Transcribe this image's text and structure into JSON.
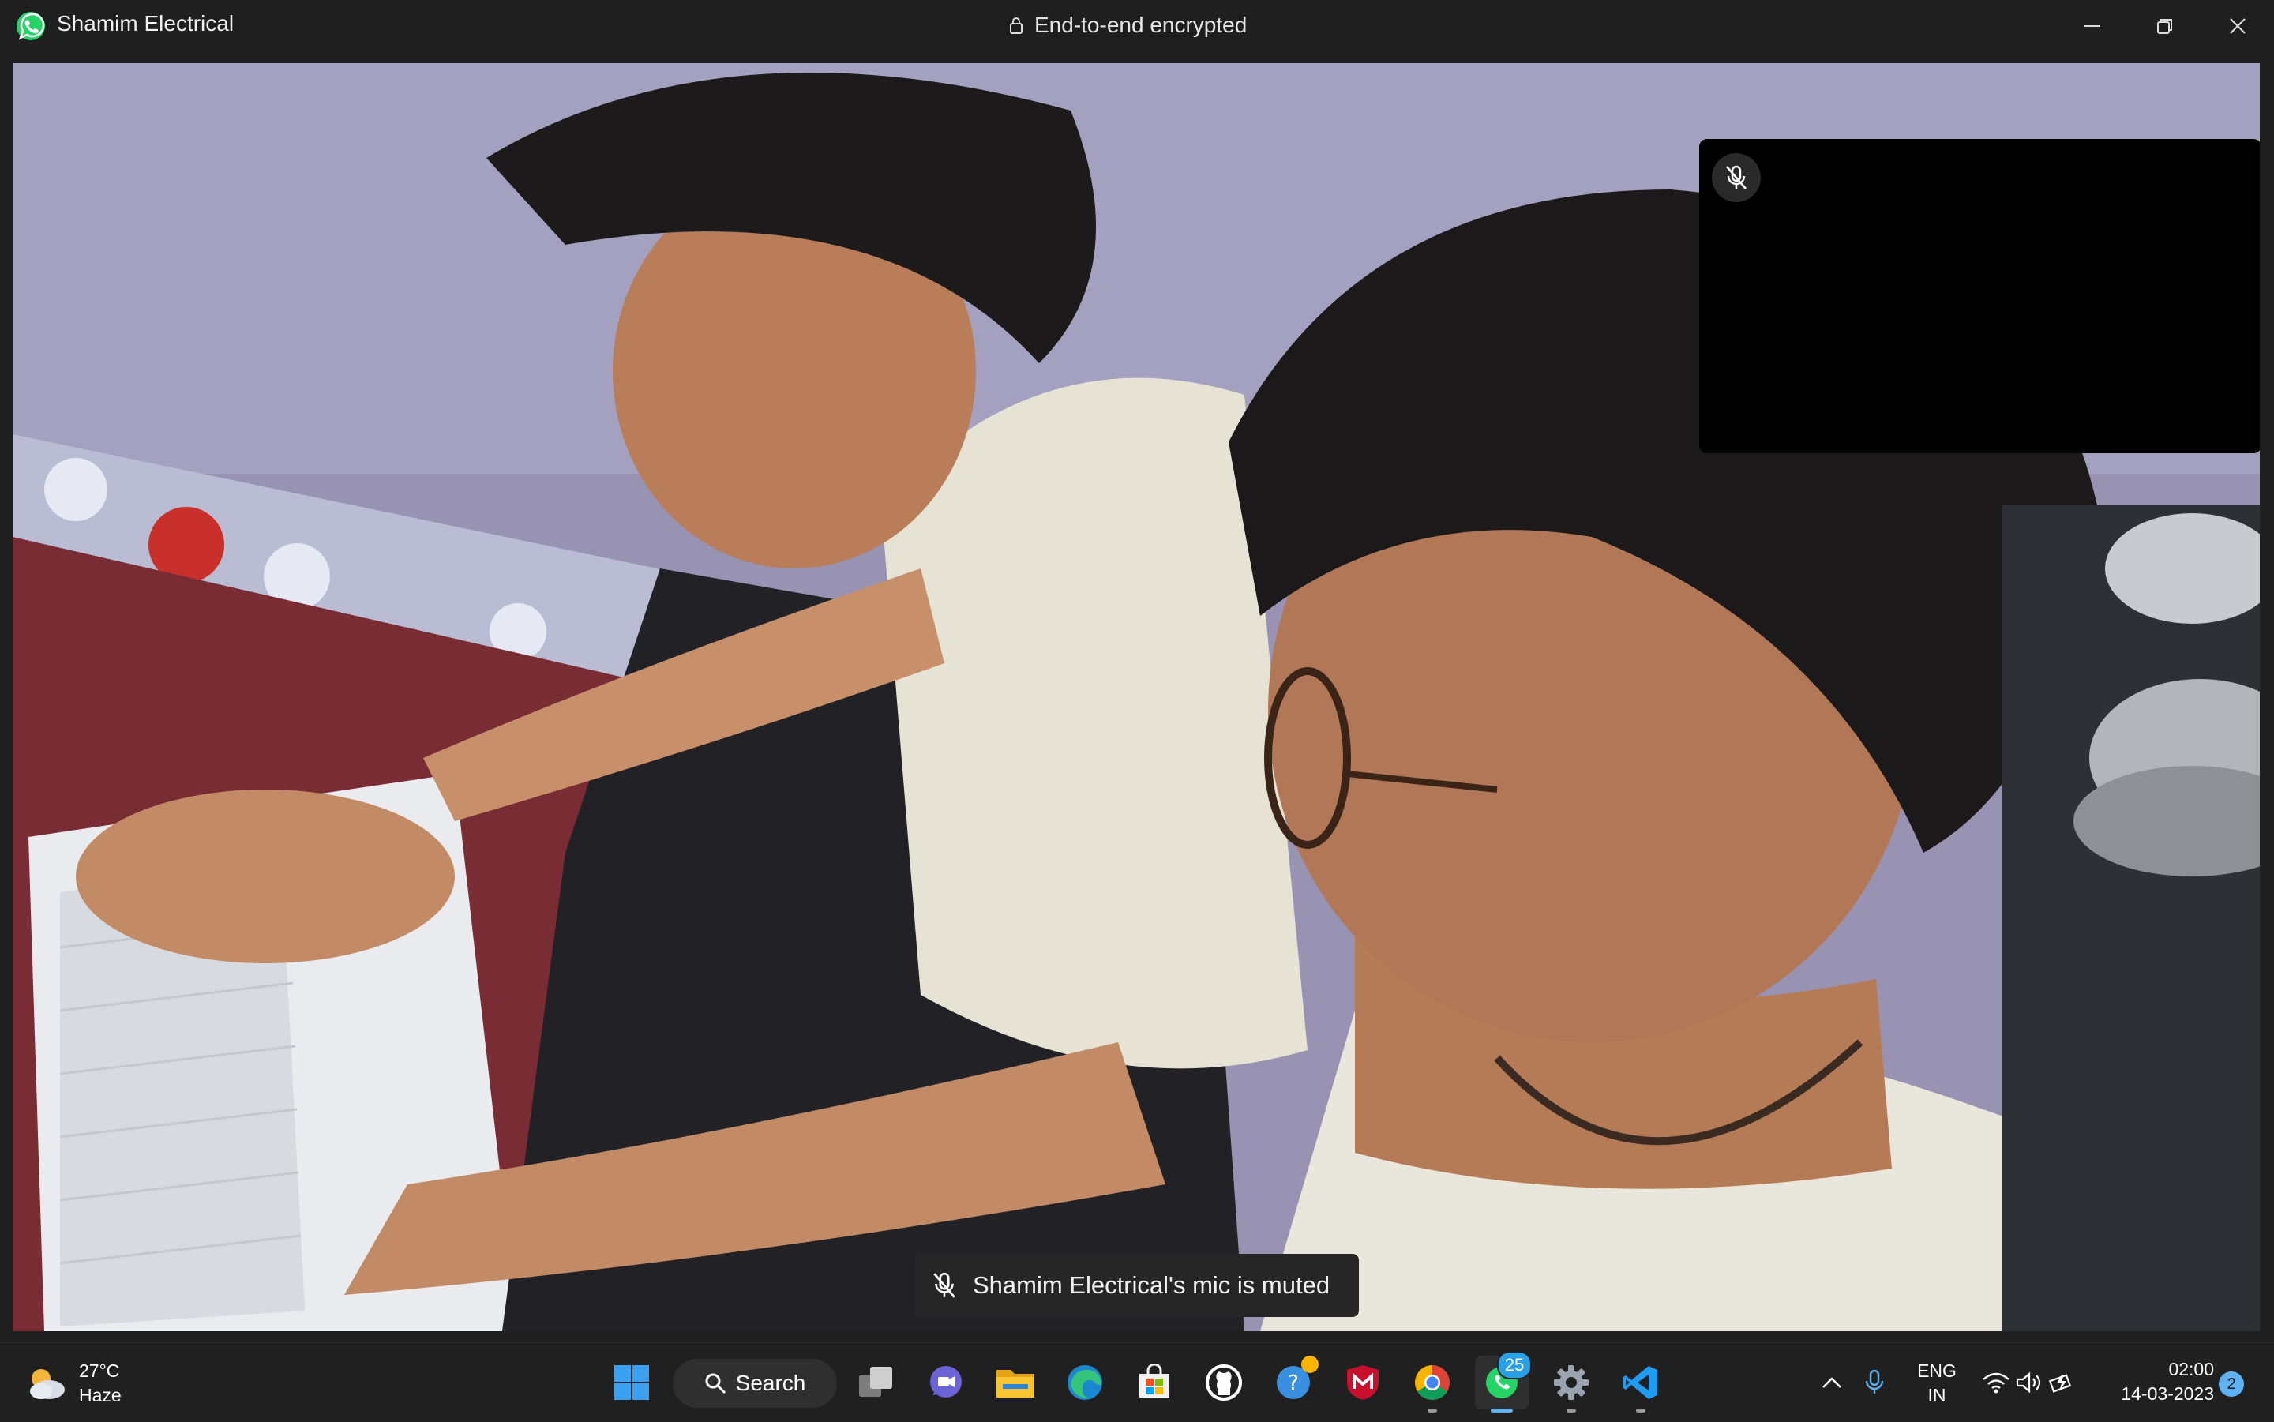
{
  "window": {
    "title": "Shamim Electrical",
    "encryption_label": "End-to-end encrypted",
    "controls": [
      "minimize",
      "restore",
      "close"
    ]
  },
  "call": {
    "remote_video": "participant-video",
    "self_view_muted": true,
    "toast_text": "Shamim Electrical's mic is muted"
  },
  "taskbar": {
    "weather": {
      "temp": "27°C",
      "condition": "Haze"
    },
    "search_label": "Search",
    "pinned_apps": [
      "start",
      "search",
      "task-view",
      "teams-chat",
      "file-explorer",
      "edge",
      "microsoft-store",
      "github-desktop",
      "get-help",
      "mcafee",
      "chrome",
      "whatsapp",
      "settings",
      "vscode"
    ],
    "whatsapp_badge": "25",
    "tray": {
      "language_line1": "ENG",
      "language_line2": "IN",
      "time": "02:00",
      "date": "14-03-2023",
      "notification_count": "2"
    }
  },
  "colors": {
    "whatsapp_green": "#25D366",
    "accent_blue": "#5fb2f2",
    "taskbar_bg": "#202020"
  }
}
